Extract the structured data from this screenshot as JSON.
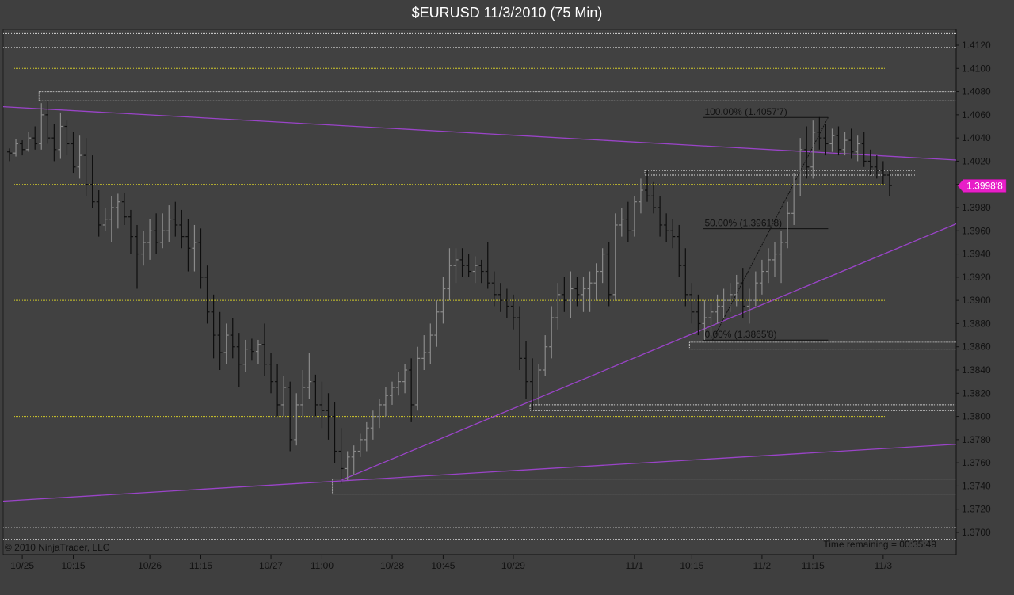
{
  "chart_data": {
    "type": "bar",
    "title": "$EURUSD  11/3/2010 (75 Min)",
    "copyright": "© 2010 NinjaTrader, LLC",
    "time_remaining": "Time remaining = 00:35:49",
    "last_price_label": "1.3998'8",
    "last_price": 1.39988,
    "ylim": [
      1.369,
      1.4134
    ],
    "y_ticks": [
      {
        "value": 1.412,
        "label": "1.4120"
      },
      {
        "value": 1.41,
        "label": "1.4100"
      },
      {
        "value": 1.408,
        "label": "1.4080"
      },
      {
        "value": 1.406,
        "label": "1.4060"
      },
      {
        "value": 1.404,
        "label": "1.4040"
      },
      {
        "value": 1.402,
        "label": "1.4020"
      },
      {
        "value": 1.4,
        "label": ""
      },
      {
        "value": 1.398,
        "label": "1.3980"
      },
      {
        "value": 1.396,
        "label": "1.3960"
      },
      {
        "value": 1.394,
        "label": "1.3940"
      },
      {
        "value": 1.392,
        "label": "1.3920"
      },
      {
        "value": 1.39,
        "label": "1.3900"
      },
      {
        "value": 1.388,
        "label": "1.3880"
      },
      {
        "value": 1.386,
        "label": "1.3860"
      },
      {
        "value": 1.384,
        "label": "1.3840"
      },
      {
        "value": 1.382,
        "label": "1.3820"
      },
      {
        "value": 1.38,
        "label": "1.3800"
      },
      {
        "value": 1.378,
        "label": "1.3780"
      },
      {
        "value": 1.376,
        "label": "1.3760"
      },
      {
        "value": 1.374,
        "label": "1.3740"
      },
      {
        "value": 1.372,
        "label": "1.3720"
      },
      {
        "value": 1.37,
        "label": "1.3700"
      }
    ],
    "x_range": [
      0,
      149
    ],
    "x_ticks": [
      {
        "bar": 2,
        "label": "10/25"
      },
      {
        "bar": 10,
        "label": "10:15"
      },
      {
        "bar": 22,
        "label": "10/26"
      },
      {
        "bar": 30,
        "label": "11:15"
      },
      {
        "bar": 41,
        "label": "10/27"
      },
      {
        "bar": 49,
        "label": "11:00"
      },
      {
        "bar": 60,
        "label": "10/28"
      },
      {
        "bar": 68,
        "label": "10:45"
      },
      {
        "bar": 79,
        "label": "10/29"
      },
      {
        "bar": 98,
        "label": "11/1"
      },
      {
        "bar": 107,
        "label": "10:15"
      },
      {
        "bar": 118,
        "label": "11/2"
      },
      {
        "bar": 126,
        "label": "11:15"
      },
      {
        "bar": 137,
        "label": "11/3"
      }
    ],
    "yellow_levels": [
      1.41,
      1.4,
      1.39,
      1.38
    ],
    "white_levels": [
      {
        "value": 1.413,
        "from": 0,
        "to": 149
      },
      {
        "value": 1.4118,
        "from": 0,
        "to": 149
      },
      {
        "value": 1.408,
        "from": 5,
        "to": 149
      },
      {
        "value": 1.4072,
        "from": 5,
        "to": 149
      },
      {
        "value": 1.4012,
        "from": 100,
        "to": 142
      },
      {
        "value": 1.4008,
        "from": 100,
        "to": 142
      },
      {
        "value": 1.3864,
        "from": 107,
        "to": 149
      },
      {
        "value": 1.3858,
        "from": 107,
        "to": 149
      },
      {
        "value": 1.381,
        "from": 82,
        "to": 149
      },
      {
        "value": 1.3805,
        "from": 82,
        "to": 149
      },
      {
        "value": 1.3746,
        "from": 51,
        "to": 149
      },
      {
        "value": 1.3733,
        "from": 51,
        "to": 149
      },
      {
        "value": 1.3704,
        "from": 0,
        "to": 149
      },
      {
        "value": 1.3694,
        "from": 0,
        "to": 149
      }
    ],
    "trend_lines": [
      {
        "x1": 0,
        "y1": 1.4067,
        "x2": 149,
        "y2": 1.4021
      },
      {
        "x1": 0,
        "y1": 1.3727,
        "x2": 149,
        "y2": 1.3776
      },
      {
        "x1": 52,
        "y1": 1.3745,
        "x2": 149,
        "y2": 1.3966
      }
    ],
    "fib": {
      "x_start": 109,
      "x_end": 128,
      "levels": [
        {
          "value": 1.40577,
          "label": "100.00% (1.4057'7)"
        },
        {
          "value": 1.39618,
          "label": "50.00% (1.3961'8)"
        },
        {
          "value": 1.38658,
          "label": "0.00% (1.3865'8)"
        }
      ]
    },
    "bars": [
      [
        1.4028,
        1.4031,
        1.402,
        1.4027
      ],
      [
        1.4027,
        1.4039,
        1.4024,
        1.4035
      ],
      [
        1.4035,
        1.4038,
        1.4025,
        1.403
      ],
      [
        1.403,
        1.4045,
        1.4028,
        1.404
      ],
      [
        1.404,
        1.405,
        1.403,
        1.4035
      ],
      [
        1.4035,
        1.407,
        1.403,
        1.406
      ],
      [
        1.406,
        1.4072,
        1.4035,
        1.404
      ],
      [
        1.404,
        1.4052,
        1.402,
        1.403
      ],
      [
        1.403,
        1.4062,
        1.4022,
        1.405
      ],
      [
        1.405,
        1.4055,
        1.4025,
        1.4035
      ],
      [
        1.4035,
        1.4045,
        1.401,
        1.4015
      ],
      [
        1.4015,
        1.4042,
        1.4005,
        1.4025
      ],
      [
        1.4025,
        1.404,
        1.399,
        1.4
      ],
      [
        1.4,
        1.4025,
        1.398,
        1.3985
      ],
      [
        1.3985,
        1.3995,
        1.3955,
        1.3965
      ],
      [
        1.3965,
        1.398,
        1.396,
        1.397
      ],
      [
        1.397,
        1.399,
        1.395,
        1.398
      ],
      [
        1.398,
        1.3992,
        1.3962,
        1.3985
      ],
      [
        1.3985,
        1.3993,
        1.3965,
        1.3972
      ],
      [
        1.3972,
        1.3978,
        1.394,
        1.3955
      ],
      [
        1.3955,
        1.3965,
        1.391,
        1.394
      ],
      [
        1.394,
        1.396,
        1.393,
        1.395
      ],
      [
        1.395,
        1.397,
        1.3935,
        1.396
      ],
      [
        1.396,
        1.3975,
        1.394,
        1.395
      ],
      [
        1.395,
        1.3975,
        1.3945,
        1.396
      ],
      [
        1.396,
        1.3982,
        1.395,
        1.397
      ],
      [
        1.397,
        1.3985,
        1.3955,
        1.3965
      ],
      [
        1.3965,
        1.3978,
        1.3945,
        1.3955
      ],
      [
        1.3955,
        1.397,
        1.3925,
        1.3945
      ],
      [
        1.3945,
        1.3965,
        1.3925,
        1.395
      ],
      [
        1.395,
        1.3962,
        1.391,
        1.392
      ],
      [
        1.392,
        1.393,
        1.388,
        1.389
      ],
      [
        1.389,
        1.3905,
        1.385,
        1.387
      ],
      [
        1.387,
        1.389,
        1.384,
        1.3855
      ],
      [
        1.3855,
        1.388,
        1.3845,
        1.387
      ],
      [
        1.387,
        1.3885,
        1.385,
        1.386
      ],
      [
        1.386,
        1.3872,
        1.3825,
        1.3845
      ],
      [
        1.3845,
        1.3866,
        1.3838,
        1.3858
      ],
      [
        1.3858,
        1.3867,
        1.3848,
        1.3856
      ],
      [
        1.3856,
        1.3866,
        1.3845,
        1.3862
      ],
      [
        1.3862,
        1.388,
        1.3835,
        1.3845
      ],
      [
        1.3845,
        1.3855,
        1.382,
        1.383
      ],
      [
        1.383,
        1.3845,
        1.38,
        1.381
      ],
      [
        1.381,
        1.3835,
        1.38,
        1.3825
      ],
      [
        1.3825,
        1.383,
        1.377,
        1.378
      ],
      [
        1.378,
        1.382,
        1.3775,
        1.381
      ],
      [
        1.381,
        1.384,
        1.38,
        1.3825
      ],
      [
        1.3825,
        1.3855,
        1.3815,
        1.383
      ],
      [
        1.383,
        1.3836,
        1.38,
        1.381
      ],
      [
        1.381,
        1.383,
        1.379,
        1.3805
      ],
      [
        1.3805,
        1.382,
        1.378,
        1.38
      ],
      [
        1.38,
        1.3812,
        1.376,
        1.377
      ],
      [
        1.377,
        1.379,
        1.3742,
        1.3755
      ],
      [
        1.3755,
        1.377,
        1.3745,
        1.3765
      ],
      [
        1.3765,
        1.3775,
        1.375,
        1.377
      ],
      [
        1.377,
        1.3785,
        1.3765,
        1.378
      ],
      [
        1.378,
        1.3795,
        1.377,
        1.379
      ],
      [
        1.379,
        1.3805,
        1.378,
        1.38
      ],
      [
        1.38,
        1.3815,
        1.379,
        1.381
      ],
      [
        1.381,
        1.3825,
        1.38,
        1.3818
      ],
      [
        1.3818,
        1.383,
        1.381,
        1.3825
      ],
      [
        1.3825,
        1.3838,
        1.3818,
        1.383
      ],
      [
        1.383,
        1.3845,
        1.382,
        1.384
      ],
      [
        1.384,
        1.385,
        1.3795,
        1.381
      ],
      [
        1.381,
        1.386,
        1.3805,
        1.385
      ],
      [
        1.385,
        1.387,
        1.384,
        1.3855
      ],
      [
        1.3855,
        1.388,
        1.3845,
        1.387
      ],
      [
        1.387,
        1.39,
        1.386,
        1.389
      ],
      [
        1.389,
        1.392,
        1.388,
        1.391
      ],
      [
        1.391,
        1.3945,
        1.39,
        1.393
      ],
      [
        1.393,
        1.3945,
        1.3915,
        1.3935
      ],
      [
        1.3935,
        1.3945,
        1.392,
        1.393
      ],
      [
        1.393,
        1.394,
        1.392,
        1.3925
      ],
      [
        1.3925,
        1.3938,
        1.3915,
        1.393
      ],
      [
        1.393,
        1.3935,
        1.3915,
        1.3925
      ],
      [
        1.3925,
        1.395,
        1.391,
        1.3915
      ],
      [
        1.3915,
        1.3925,
        1.3895,
        1.3905
      ],
      [
        1.3905,
        1.3915,
        1.389,
        1.39
      ],
      [
        1.39,
        1.391,
        1.3885,
        1.3895
      ],
      [
        1.3895,
        1.3905,
        1.3875,
        1.3885
      ],
      [
        1.3885,
        1.3895,
        1.384,
        1.385
      ],
      [
        1.385,
        1.3865,
        1.3815,
        1.383
      ],
      [
        1.383,
        1.385,
        1.3805,
        1.3815
      ],
      [
        1.3815,
        1.3845,
        1.381,
        1.384
      ],
      [
        1.384,
        1.387,
        1.3835,
        1.386
      ],
      [
        1.386,
        1.3895,
        1.385,
        1.3885
      ],
      [
        1.3885,
        1.3915,
        1.3875,
        1.3905
      ],
      [
        1.3905,
        1.392,
        1.389,
        1.39
      ],
      [
        1.39,
        1.3925,
        1.3885,
        1.391
      ],
      [
        1.391,
        1.392,
        1.3895,
        1.3905
      ],
      [
        1.3905,
        1.392,
        1.389,
        1.391
      ],
      [
        1.391,
        1.3925,
        1.389,
        1.3915
      ],
      [
        1.3915,
        1.3932,
        1.39,
        1.3925
      ],
      [
        1.3925,
        1.3945,
        1.3915,
        1.394
      ],
      [
        1.394,
        1.395,
        1.3895,
        1.3905
      ],
      [
        1.3905,
        1.3975,
        1.39,
        1.3965
      ],
      [
        1.3965,
        1.398,
        1.3955,
        1.397
      ],
      [
        1.397,
        1.3985,
        1.395,
        1.396
      ],
      [
        1.396,
        1.399,
        1.3955,
        1.3985
      ],
      [
        1.3985,
        1.4005,
        1.3975,
        1.3995
      ],
      [
        1.3995,
        1.4012,
        1.3985,
        1.399
      ],
      [
        1.399,
        1.4002,
        1.3975,
        1.398
      ],
      [
        1.398,
        1.399,
        1.3955,
        1.3965
      ],
      [
        1.3965,
        1.3975,
        1.395,
        1.396
      ],
      [
        1.396,
        1.397,
        1.3945,
        1.3955
      ],
      [
        1.3955,
        1.3965,
        1.392,
        1.393
      ],
      [
        1.393,
        1.3945,
        1.3895,
        1.3905
      ],
      [
        1.3905,
        1.3915,
        1.388,
        1.389
      ],
      [
        1.389,
        1.3905,
        1.387,
        1.388
      ],
      [
        1.388,
        1.39,
        1.3866,
        1.3885
      ],
      [
        1.3885,
        1.3898,
        1.387,
        1.389
      ],
      [
        1.389,
        1.3905,
        1.388,
        1.3895
      ],
      [
        1.3895,
        1.391,
        1.3885,
        1.39
      ],
      [
        1.39,
        1.3915,
        1.389,
        1.3905
      ],
      [
        1.3905,
        1.3922,
        1.3895,
        1.3915
      ],
      [
        1.3915,
        1.3928,
        1.3885,
        1.3895
      ],
      [
        1.3895,
        1.391,
        1.388,
        1.39
      ],
      [
        1.39,
        1.3925,
        1.3895,
        1.3915
      ],
      [
        1.3915,
        1.3935,
        1.3905,
        1.3925
      ],
      [
        1.3925,
        1.3945,
        1.3915,
        1.3935
      ],
      [
        1.3935,
        1.395,
        1.392,
        1.394
      ],
      [
        1.394,
        1.396,
        1.3915,
        1.395
      ],
      [
        1.395,
        1.3985,
        1.3945,
        1.3975
      ],
      [
        1.3975,
        1.401,
        1.3965,
        1.4
      ],
      [
        1.4,
        1.404,
        1.399,
        1.403
      ],
      [
        1.403,
        1.405,
        1.4005,
        1.4015
      ],
      [
        1.4015,
        1.4055,
        1.4005,
        1.4045
      ],
      [
        1.4045,
        1.4058,
        1.403,
        1.404
      ],
      [
        1.404,
        1.4052,
        1.4025,
        1.4035
      ],
      [
        1.4035,
        1.4048,
        1.4028,
        1.4042
      ],
      [
        1.4042,
        1.405,
        1.4025,
        1.403
      ],
      [
        1.403,
        1.4045,
        1.4025,
        1.4038
      ],
      [
        1.4038,
        1.4048,
        1.4022,
        1.4028
      ],
      [
        1.4028,
        1.4042,
        1.402,
        1.4035
      ],
      [
        1.4035,
        1.4045,
        1.4015,
        1.402
      ],
      [
        1.402,
        1.403,
        1.4008,
        1.4015
      ],
      [
        1.4015,
        1.4025,
        1.4005,
        1.4012
      ],
      [
        1.4012,
        1.402,
        1.4,
        1.4008
      ],
      [
        1.4008,
        1.4012,
        1.399,
        1.3999
      ]
    ]
  }
}
